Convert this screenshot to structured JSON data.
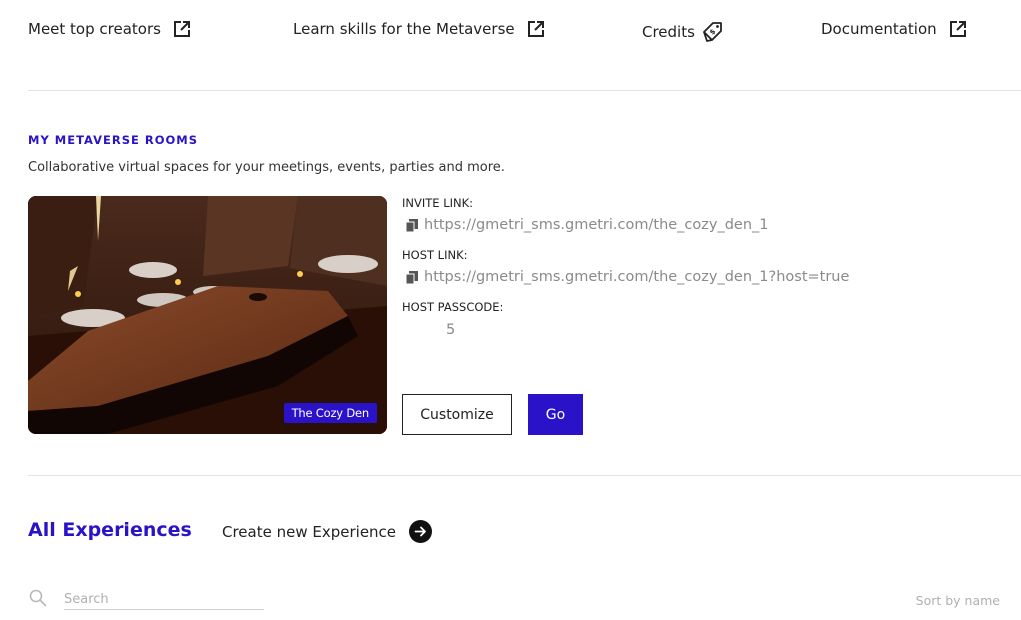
{
  "top_links": [
    {
      "label": "Meet top creators",
      "icon": "external-link-icon"
    },
    {
      "label": "Learn skills for the Metaverse",
      "icon": "external-link-icon"
    },
    {
      "label": "Credits",
      "icon": "tag-icon"
    },
    {
      "label": "Documentation",
      "icon": "external-link-icon"
    }
  ],
  "rooms_section": {
    "label": "MY METAVERSE ROOMS",
    "description": "Collaborative virtual spaces for your meetings, events, parties and more."
  },
  "room": {
    "name": "The Cozy Den",
    "invite_label": "INVITE LINK:",
    "invite_link": "https://gmetri_sms.gmetri.com/the_cozy_den_1",
    "host_label": "HOST LINK:",
    "host_link": "https://gmetri_sms.gmetri.com/the_cozy_den_1?host=true",
    "passcode_label": "HOST PASSCODE:",
    "passcode": "5",
    "customize_label": "Customize",
    "go_label": "Go"
  },
  "experiences": {
    "title": "All Experiences",
    "create_label": "Create new Experience",
    "search_placeholder": "Search",
    "sort_label": "Sort by name"
  },
  "colors": {
    "accent": "#2a12c8",
    "text": "#222222",
    "muted": "#8a8a8a",
    "divider": "#e3e3e3"
  }
}
